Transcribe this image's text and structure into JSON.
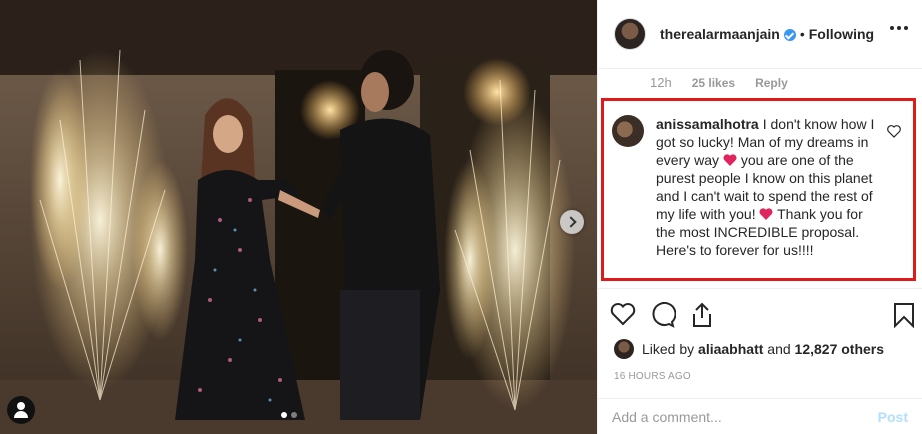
{
  "post": {
    "image_alt": "Couple holding hands between sparkler fountains",
    "carousel": {
      "total": 2,
      "active": 0
    }
  },
  "header": {
    "username": "therealarmaanjain",
    "verified": true,
    "separator": "•",
    "follow_state": "Following"
  },
  "prev_comment_meta": {
    "time": "12h",
    "likes": "25 likes",
    "reply": "Reply"
  },
  "comment": {
    "username": "anissamalhotra",
    "part1": "I don't know how I got so lucky! Man of my dreams in every way",
    "part2": "you are one of the purest people I know on this planet and I can't wait to spend the rest of my life with you!",
    "part3": "Thank you for the most INCREDIBLE proposal. Here's to forever for us!!!!"
  },
  "likes": {
    "prefix": "Liked by",
    "user": "aliaabhatt",
    "connector": "and",
    "others": "12,827 others"
  },
  "time_ago": "16 HOURS AGO",
  "comment_bar": {
    "placeholder": "Add a comment...",
    "post_label": "Post"
  },
  "colors": {
    "highlight_border": "#e01a1a",
    "verified": "#3897f0",
    "heart": "#ed4956",
    "post_disabled": "#b2dffc"
  }
}
